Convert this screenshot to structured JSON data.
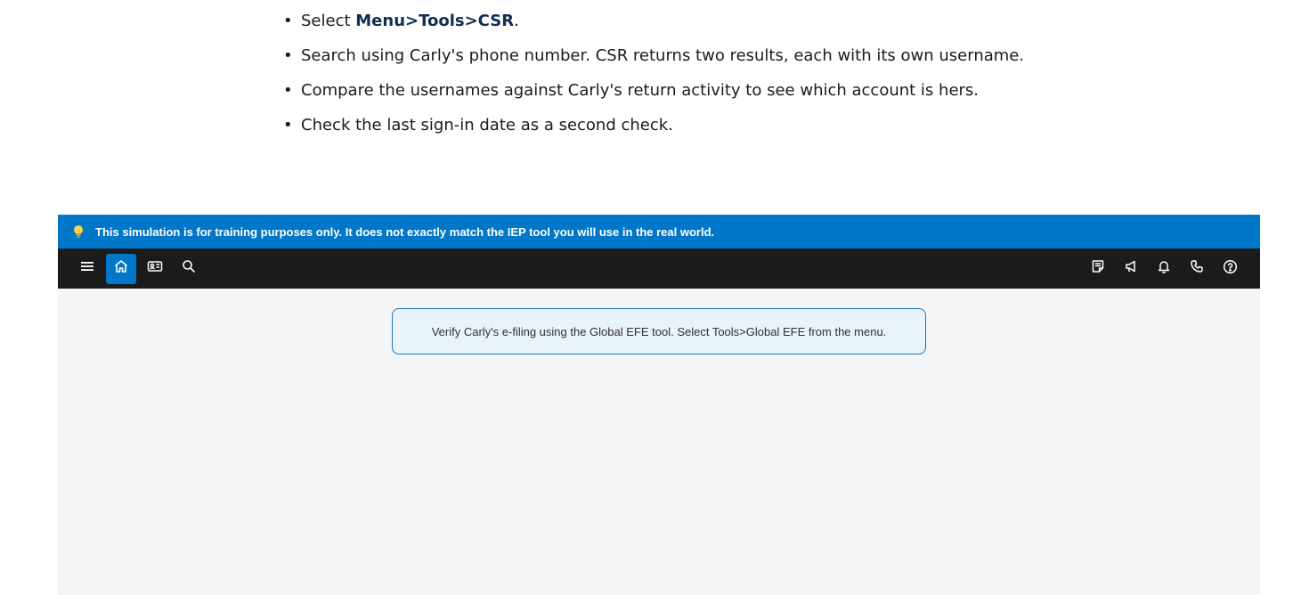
{
  "instructions": [
    {
      "prefix": "Select ",
      "bold": "Menu>Tools>CSR",
      "suffix": "."
    },
    {
      "prefix": "Search using Carly's phone number. CSR returns two results, each with its own username.",
      "bold": "",
      "suffix": ""
    },
    {
      "prefix": "Compare the usernames against Carly's return activity to see which account is hers.",
      "bold": "",
      "suffix": ""
    },
    {
      "prefix": "Check the last sign-in date as a second check.",
      "bold": "",
      "suffix": ""
    }
  ],
  "simulation": {
    "banner_text": "This simulation is for training purposes only. It does not exactly match the IEP tool you will use in the real world.",
    "banner_color": "#0077c8",
    "toolbar_color": "#1b1b1b",
    "toolbar_left_icons": [
      "menu-icon",
      "home-icon",
      "id-card-icon",
      "search-icon"
    ],
    "toolbar_right_icons": [
      "notes-icon",
      "announcement-icon",
      "bell-icon",
      "phone-icon",
      "help-icon"
    ],
    "active_icon": "home-icon",
    "message": "Verify Carly's e-filing using the Global EFE tool. Select Tools>Global EFE from the menu."
  }
}
